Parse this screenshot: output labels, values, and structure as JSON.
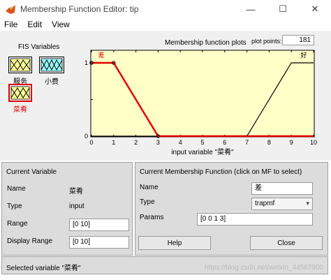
{
  "window": {
    "title": "Membership Function Editor: tip",
    "minimize_glyph": "—",
    "maximize_glyph": "☐",
    "close_glyph": "✕"
  },
  "menu": [
    "File",
    "Edit",
    "View"
  ],
  "fis_variables": {
    "label": "FIS Variables",
    "items": [
      {
        "name": "服务",
        "selected": false,
        "color": "#ffff99"
      },
      {
        "name": "小费",
        "selected": false,
        "color": "#99ffff"
      },
      {
        "name": "菜肴",
        "selected": true,
        "color": "#ffff99"
      }
    ]
  },
  "plot": {
    "title": "Membership function plots",
    "plot_points_label": "plot points:",
    "plot_points_value": "181",
    "xlabel": "input variable \"菜肴\""
  },
  "chart_data": {
    "type": "line",
    "xlim": [
      0,
      10
    ],
    "ylim": [
      0,
      1
    ],
    "x_ticks": [
      "0",
      "1",
      "2",
      "3",
      "4",
      "5",
      "6",
      "7",
      "8",
      "9",
      "10"
    ],
    "y_ticks": [
      "0",
      "0.5",
      "1"
    ],
    "background": "#ffffc8",
    "series": [
      {
        "name": "差",
        "type": "trapmf",
        "params": [
          0,
          0,
          1,
          3
        ],
        "color": "#e00000",
        "selected": true
      },
      {
        "name": "好",
        "type": "trapmf",
        "params": [
          7,
          9,
          10,
          10
        ],
        "color": "#000000",
        "selected": false
      }
    ]
  },
  "current_variable": {
    "title": "Current Variable",
    "name_label": "Name",
    "name_value": "菜肴",
    "type_label": "Type",
    "type_value": "input",
    "range_label": "Range",
    "range_value": "[0 10]",
    "display_range_label": "Display Range",
    "display_range_value": "[0 10]"
  },
  "current_mf": {
    "title": "Current Membership Function (click on MF to select)",
    "name_label": "Name",
    "name_value": "差",
    "type_label": "Type",
    "type_value": "trapmf",
    "params_label": "Params",
    "params_value": "[0 0 1 3]"
  },
  "buttons": {
    "help": "Help",
    "close": "Close"
  },
  "status": {
    "text": "Selected variable \"菜肴\"",
    "watermark": "https://blog.csdn.net/weixin_44567900"
  },
  "colors": {
    "selected": "#e00000",
    "panel": "#dcdcdc",
    "plot_bg": "#ffffc8"
  }
}
